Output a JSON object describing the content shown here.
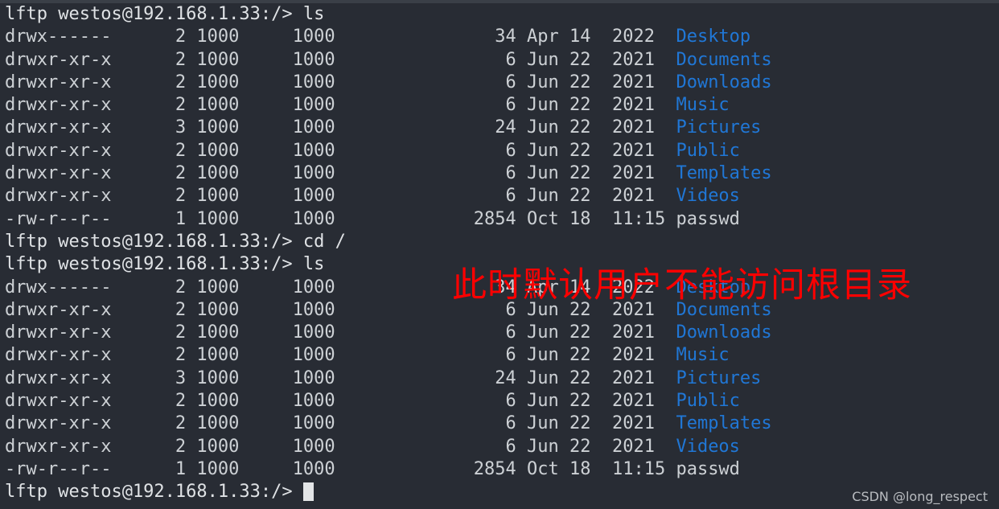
{
  "terminal": {
    "prompt": "lftp westos@192.168.1.33:/> ",
    "lines": [
      {
        "type": "prompt",
        "prompt": "lftp westos@192.168.1.33:/> ",
        "command": "ls"
      },
      {
        "type": "listing",
        "perms": "drwx------",
        "links": "2",
        "owner": "1000",
        "group": "1000",
        "size": "34",
        "month": "Apr",
        "day": "14",
        "year": "2022",
        "name": "Desktop",
        "is_dir": true
      },
      {
        "type": "listing",
        "perms": "drwxr-xr-x",
        "links": "2",
        "owner": "1000",
        "group": "1000",
        "size": "6",
        "month": "Jun",
        "day": "22",
        "year": "2021",
        "name": "Documents",
        "is_dir": true
      },
      {
        "type": "listing",
        "perms": "drwxr-xr-x",
        "links": "2",
        "owner": "1000",
        "group": "1000",
        "size": "6",
        "month": "Jun",
        "day": "22",
        "year": "2021",
        "name": "Downloads",
        "is_dir": true
      },
      {
        "type": "listing",
        "perms": "drwxr-xr-x",
        "links": "2",
        "owner": "1000",
        "group": "1000",
        "size": "6",
        "month": "Jun",
        "day": "22",
        "year": "2021",
        "name": "Music",
        "is_dir": true
      },
      {
        "type": "listing",
        "perms": "drwxr-xr-x",
        "links": "3",
        "owner": "1000",
        "group": "1000",
        "size": "24",
        "month": "Jun",
        "day": "22",
        "year": "2021",
        "name": "Pictures",
        "is_dir": true
      },
      {
        "type": "listing",
        "perms": "drwxr-xr-x",
        "links": "2",
        "owner": "1000",
        "group": "1000",
        "size": "6",
        "month": "Jun",
        "day": "22",
        "year": "2021",
        "name": "Public",
        "is_dir": true
      },
      {
        "type": "listing",
        "perms": "drwxr-xr-x",
        "links": "2",
        "owner": "1000",
        "group": "1000",
        "size": "6",
        "month": "Jun",
        "day": "22",
        "year": "2021",
        "name": "Templates",
        "is_dir": true
      },
      {
        "type": "listing",
        "perms": "drwxr-xr-x",
        "links": "2",
        "owner": "1000",
        "group": "1000",
        "size": "6",
        "month": "Jun",
        "day": "22",
        "year": "2021",
        "name": "Videos",
        "is_dir": true
      },
      {
        "type": "listing",
        "perms": "-rw-r--r--",
        "links": "1",
        "owner": "1000",
        "group": "1000",
        "size": "2854",
        "month": "Oct",
        "day": "18",
        "year": "11:15",
        "name": "passwd",
        "is_dir": false
      },
      {
        "type": "prompt",
        "prompt": "lftp westos@192.168.1.33:/> ",
        "command": "cd /"
      },
      {
        "type": "prompt",
        "prompt": "lftp westos@192.168.1.33:/> ",
        "command": "ls"
      },
      {
        "type": "listing",
        "perms": "drwx------",
        "links": "2",
        "owner": "1000",
        "group": "1000",
        "size": "34",
        "month": "Apr",
        "day": "14",
        "year": "2022",
        "name": "Desktop",
        "is_dir": true
      },
      {
        "type": "listing",
        "perms": "drwxr-xr-x",
        "links": "2",
        "owner": "1000",
        "group": "1000",
        "size": "6",
        "month": "Jun",
        "day": "22",
        "year": "2021",
        "name": "Documents",
        "is_dir": true
      },
      {
        "type": "listing",
        "perms": "drwxr-xr-x",
        "links": "2",
        "owner": "1000",
        "group": "1000",
        "size": "6",
        "month": "Jun",
        "day": "22",
        "year": "2021",
        "name": "Downloads",
        "is_dir": true
      },
      {
        "type": "listing",
        "perms": "drwxr-xr-x",
        "links": "2",
        "owner": "1000",
        "group": "1000",
        "size": "6",
        "month": "Jun",
        "day": "22",
        "year": "2021",
        "name": "Music",
        "is_dir": true
      },
      {
        "type": "listing",
        "perms": "drwxr-xr-x",
        "links": "3",
        "owner": "1000",
        "group": "1000",
        "size": "24",
        "month": "Jun",
        "day": "22",
        "year": "2021",
        "name": "Pictures",
        "is_dir": true
      },
      {
        "type": "listing",
        "perms": "drwxr-xr-x",
        "links": "2",
        "owner": "1000",
        "group": "1000",
        "size": "6",
        "month": "Jun",
        "day": "22",
        "year": "2021",
        "name": "Public",
        "is_dir": true
      },
      {
        "type": "listing",
        "perms": "drwxr-xr-x",
        "links": "2",
        "owner": "1000",
        "group": "1000",
        "size": "6",
        "month": "Jun",
        "day": "22",
        "year": "2021",
        "name": "Templates",
        "is_dir": true
      },
      {
        "type": "listing",
        "perms": "drwxr-xr-x",
        "links": "2",
        "owner": "1000",
        "group": "1000",
        "size": "6",
        "month": "Jun",
        "day": "22",
        "year": "2021",
        "name": "Videos",
        "is_dir": true
      },
      {
        "type": "listing",
        "perms": "-rw-r--r--",
        "links": "1",
        "owner": "1000",
        "group": "1000",
        "size": "2854",
        "month": "Oct",
        "day": "18",
        "year": "11:15",
        "name": "passwd",
        "is_dir": false
      },
      {
        "type": "prompt",
        "prompt": "lftp westos@192.168.1.33:/> ",
        "command": "",
        "cursor": true
      }
    ]
  },
  "annotation": {
    "text": "此时默认用户不能访问根目录",
    "color": "#ff0000"
  },
  "watermark": {
    "text": "CSDN @long_respect"
  },
  "colors": {
    "background": "#282c34",
    "foreground": "#cdd1d5",
    "directory_blue": "#2077d6",
    "annotation_red": "#ff0000",
    "titlebar": "#3a3f47"
  }
}
